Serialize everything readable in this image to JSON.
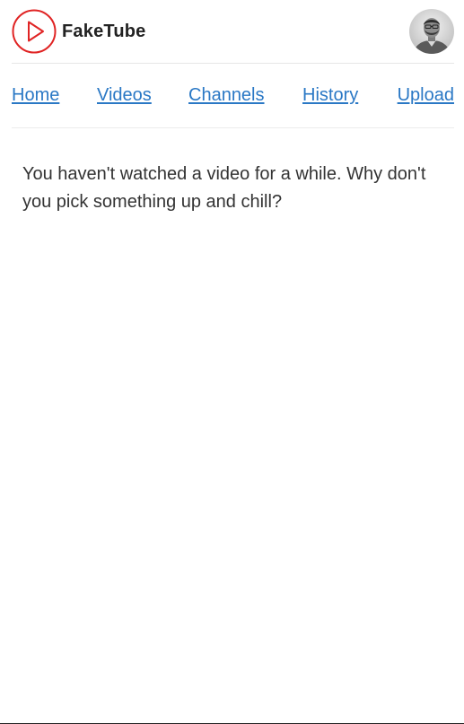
{
  "header": {
    "app_name": "FakeTube",
    "logo_icon": "play-circle-icon",
    "avatar_icon": "user-avatar",
    "brand_color": "#e02424"
  },
  "nav": {
    "items": [
      {
        "label": "Home"
      },
      {
        "label": "Videos"
      },
      {
        "label": "Channels"
      },
      {
        "label": "History"
      },
      {
        "label": "Upload"
      }
    ],
    "link_color": "#2a78c5"
  },
  "main": {
    "message": "You haven't watched a video for a while. Why don't you pick something up and chill?"
  }
}
